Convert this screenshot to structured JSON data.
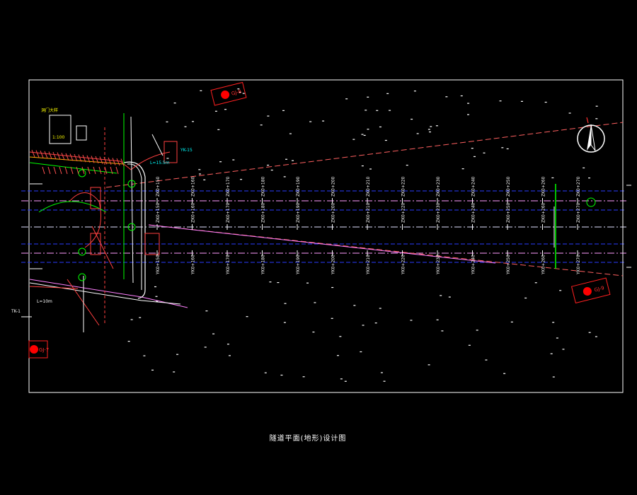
{
  "title": "隧道平面(地形)设计图",
  "markers": [
    {
      "label": "GJ-8"
    },
    {
      "label": "GJ-9"
    },
    {
      "label": "GJ-7"
    }
  ],
  "station_labels_top": [
    "ZK0+150",
    "ZK0+160",
    "ZK0+170",
    "ZK0+180",
    "ZK0+190",
    "ZK0+200",
    "ZK0+210",
    "ZK0+220",
    "ZK0+230",
    "ZK0+240",
    "ZK0+250",
    "ZK0+260",
    "ZK0+270"
  ],
  "station_labels_bottom": [
    "YK0+150",
    "YK0+160",
    "YK0+170",
    "YK0+180",
    "YK0+190",
    "YK0+200",
    "YK0+210",
    "YK0+220",
    "YK0+230",
    "YK0+240",
    "YK0+250",
    "YK0+260",
    "YK0+270"
  ],
  "notes": {
    "design_length": "L=15.5m",
    "left_length": "L=10m",
    "yk_label": "YK-15",
    "tk_label": "TK-1",
    "portal_box": "洞门大样",
    "portal_scale": "1:100"
  },
  "colors": {
    "frame": "#ffffff",
    "centerline": "#ff80ff",
    "edge": "#0000ff",
    "marker": "#ff0000",
    "tunnel_box": "#ffffff",
    "cyan": "#00ffff",
    "green": "#00ff00",
    "yellow": "#ffff00"
  },
  "icons": [
    "north-arrow-icon"
  ]
}
